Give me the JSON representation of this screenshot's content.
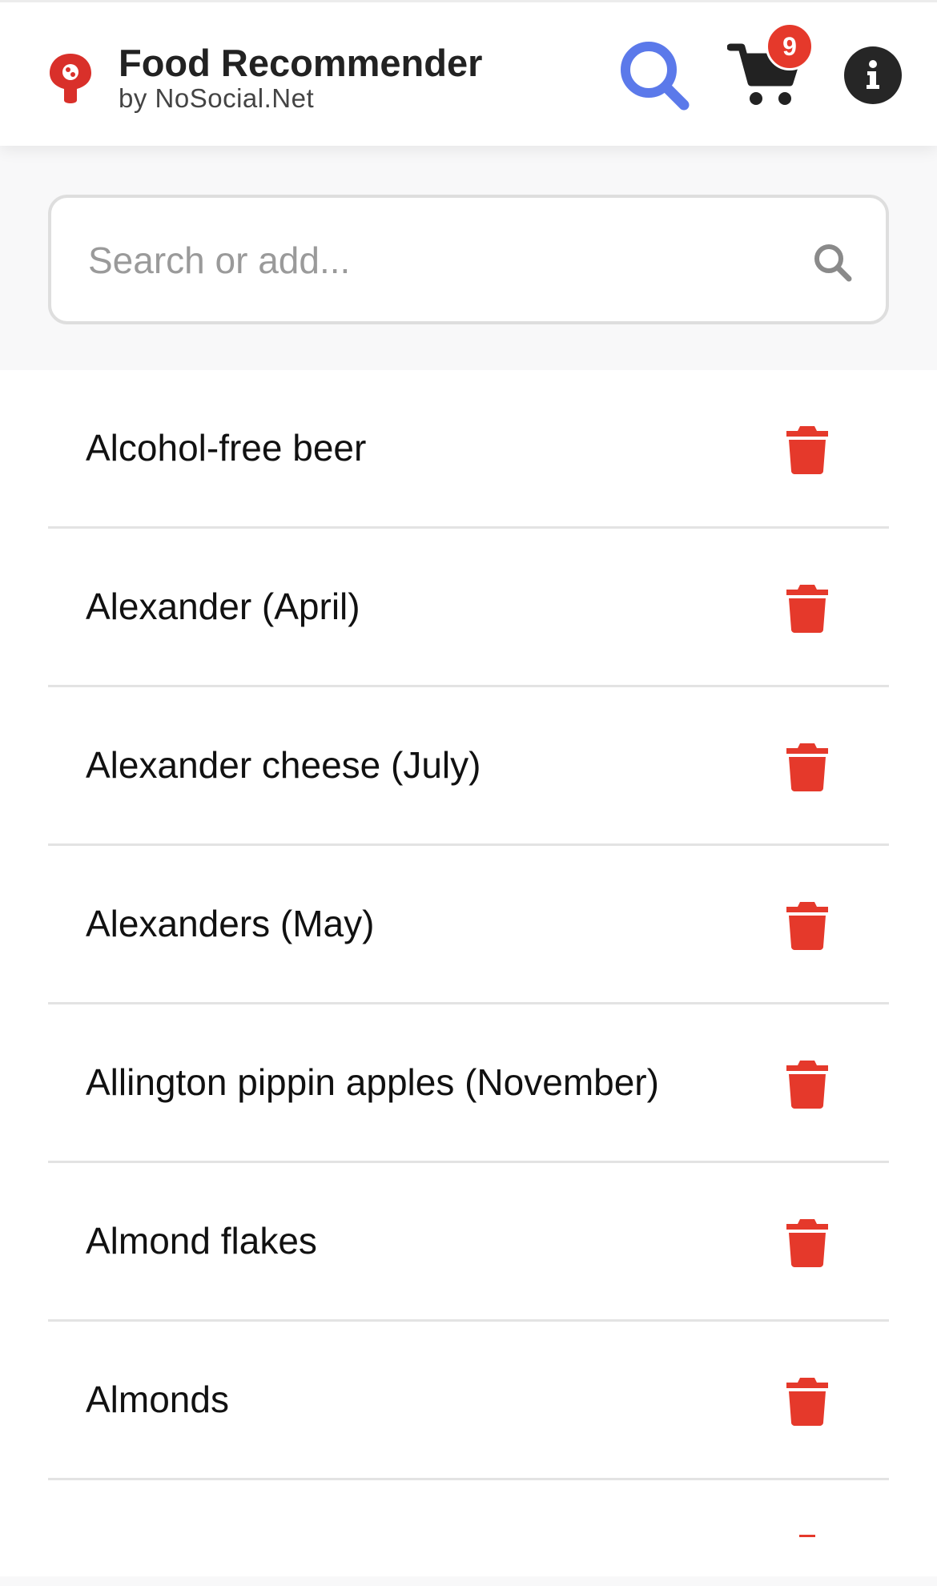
{
  "header": {
    "title": "Food Recommender",
    "subtitle": "by NoSocial.Net",
    "cart_count": "9",
    "logo_icon": "map-pin-logo-icon",
    "search_icon": "search-icon",
    "cart_icon": "shopping-cart-icon",
    "info_icon": "info-icon"
  },
  "search": {
    "placeholder": "Search or add...",
    "value": "",
    "icon": "search-icon"
  },
  "items": [
    {
      "label": "Alcohol-free beer",
      "icon": "trash-icon"
    },
    {
      "label": "Alexander (April)",
      "icon": "trash-icon"
    },
    {
      "label": "Alexander cheese (July)",
      "icon": "trash-icon"
    },
    {
      "label": "Alexanders (May)",
      "icon": "trash-icon"
    },
    {
      "label": "Allington pippin apples (November)",
      "icon": "trash-icon"
    },
    {
      "label": "Almond flakes",
      "icon": "trash-icon"
    },
    {
      "label": "Almonds",
      "icon": "trash-icon"
    }
  ],
  "colors": {
    "accent_blue": "#5b79ea",
    "delete_red": "#e5392b",
    "badge_red": "#e5392b",
    "info_dark": "#262626",
    "logo_red": "#d9302a"
  }
}
